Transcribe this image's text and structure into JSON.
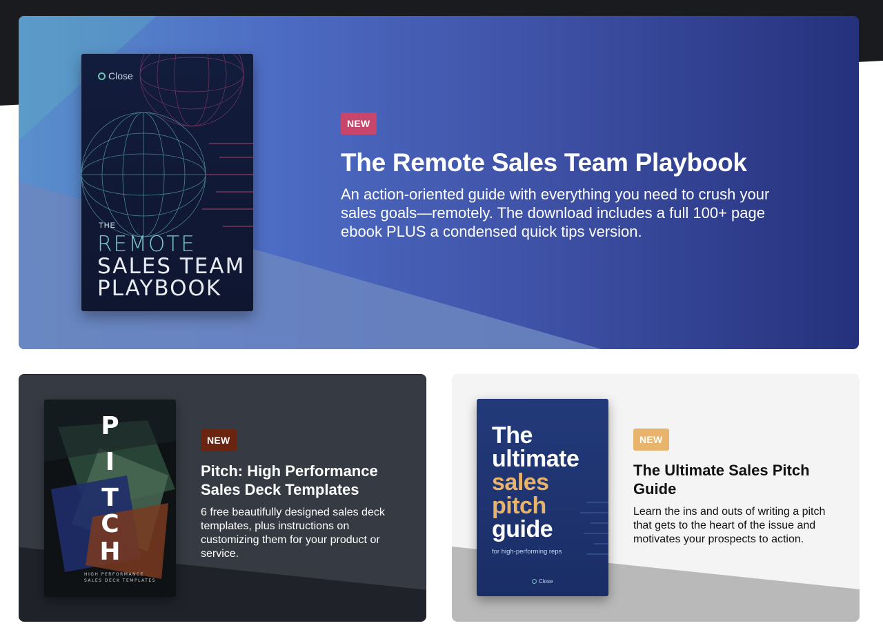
{
  "colors": {
    "top_band": "#1a1b1f",
    "hero_gradient_start": "#5a8fcc",
    "hero_gradient_end": "#25317c",
    "hero_badge": "#c8456b",
    "pitch_card_bg": "#363a42",
    "pitch_badge": "#6a2410",
    "guide_card_bg": "#f4f4f4",
    "guide_badge": "#e8b46c"
  },
  "hero": {
    "badge": "NEW",
    "title": "The Remote Sales Team Playbook",
    "description": "An action-oriented guide with everything you need to crush your sales goals—remotely. The download includes a full 100+ page ebook PLUS a condensed quick tips version.",
    "cover": {
      "brand": "Close",
      "line_the": "THE",
      "line_1": "REMOTE",
      "line_2": "SALES TEAM",
      "line_3": "PLAYBOOK"
    }
  },
  "cards": {
    "pitch": {
      "badge": "NEW",
      "title": "Pitch: High Performance Sales Deck Templates",
      "description": "6 free beautifully designed sales deck templates, plus instructions on customizing them for your product or service.",
      "cover": {
        "letters": [
          "P",
          "I",
          "T",
          "C",
          "H"
        ],
        "subtitle_1": "HIGH PERFORMANCE",
        "subtitle_2": "SALES DECK TEMPLATES"
      }
    },
    "guide": {
      "badge": "NEW",
      "title": "The Ultimate Sales Pitch Guide",
      "description": "Learn the ins and outs of writing a pitch that gets to the heart of the issue and motivates your prospects to action.",
      "cover": {
        "line_1": "The",
        "line_2": "ultimate",
        "line_3": "sales",
        "line_4": "pitch",
        "line_5": "guide",
        "subtitle": "for high-performing reps",
        "brand": "Close"
      }
    }
  }
}
